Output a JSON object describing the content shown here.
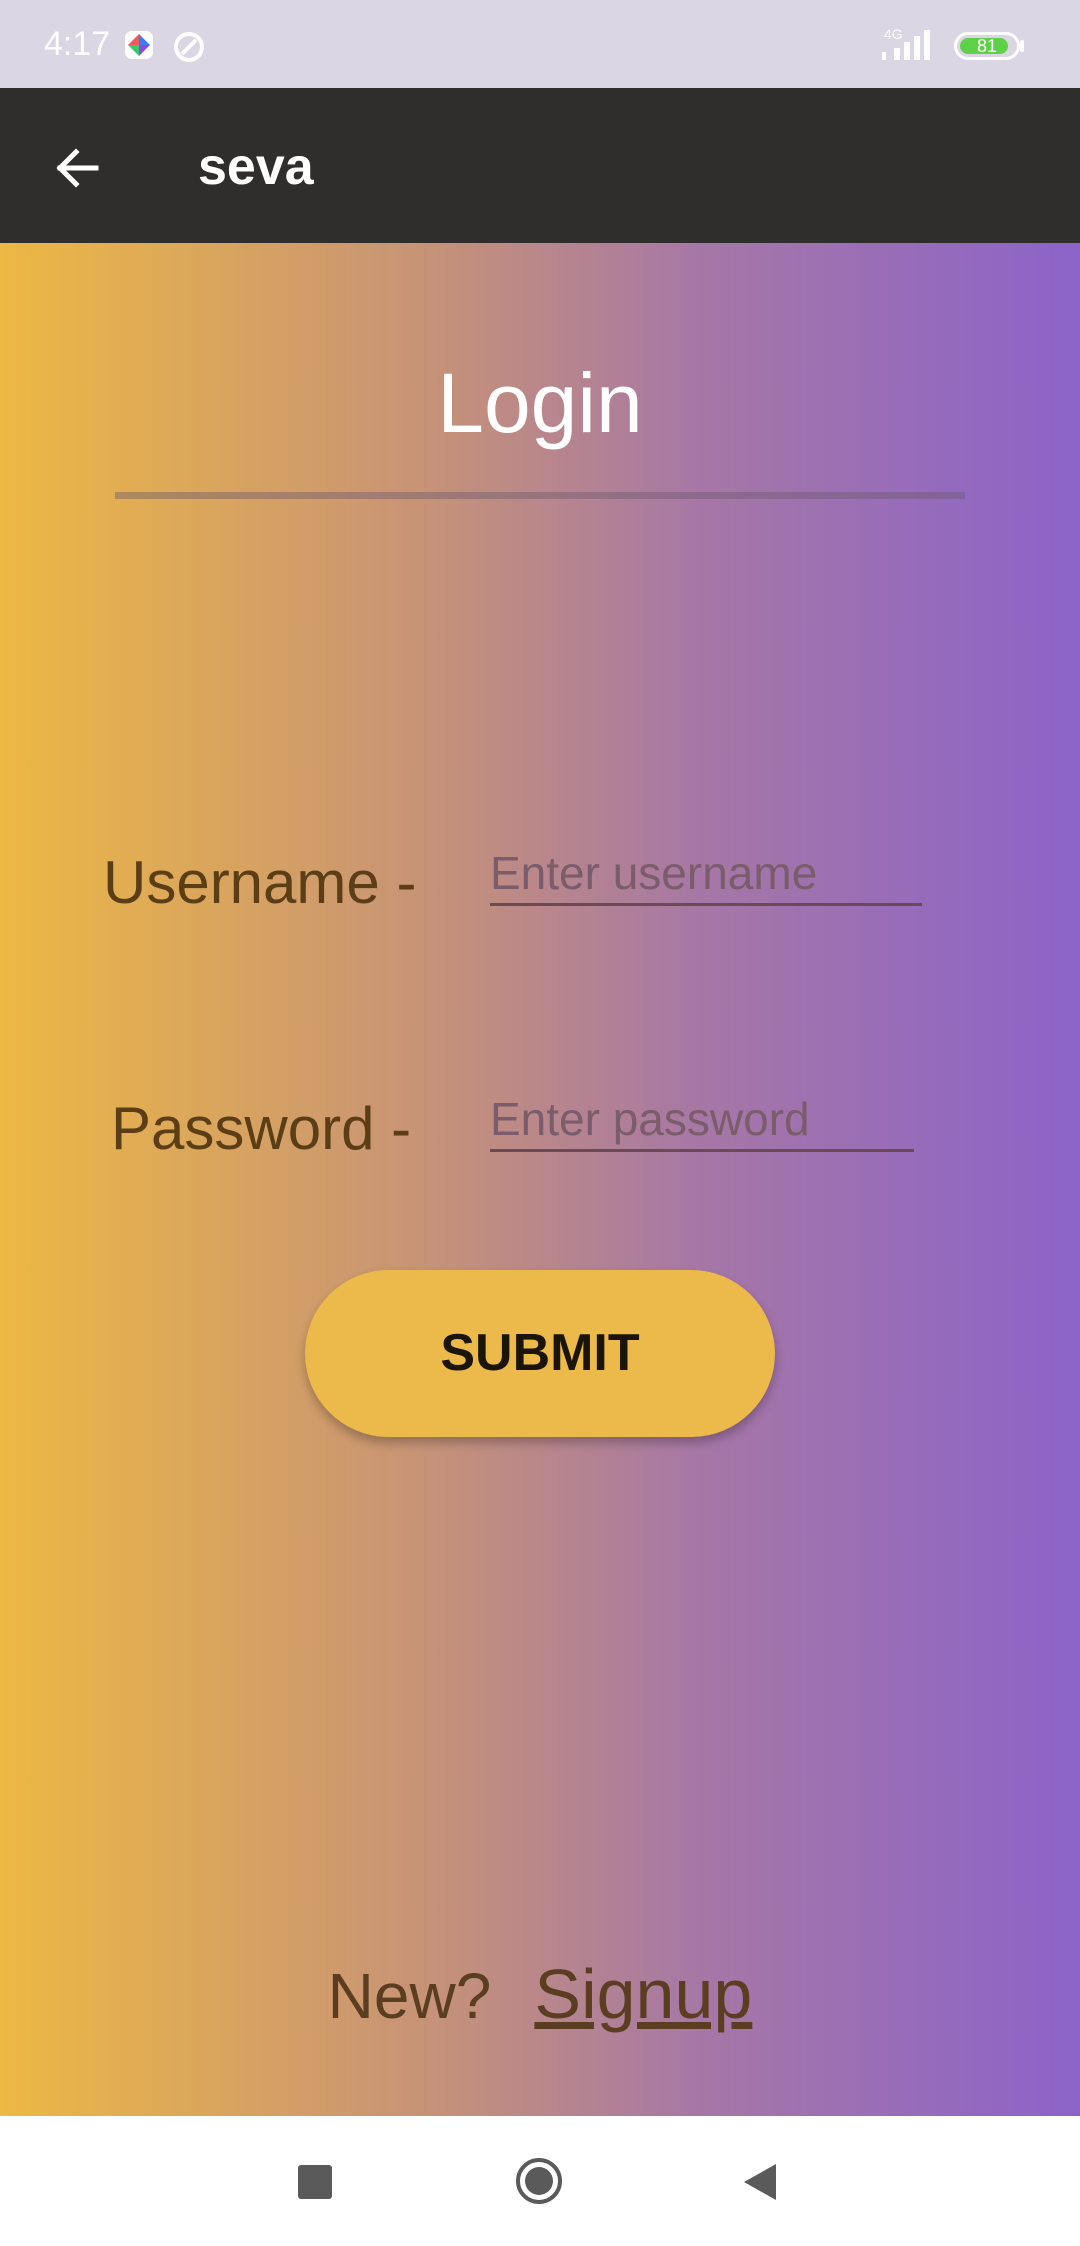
{
  "status_bar": {
    "time": "4:17",
    "network": "4G",
    "battery": "81"
  },
  "app_bar": {
    "title": "seva"
  },
  "login": {
    "title": "Login",
    "username_label": "Username -",
    "username_placeholder": "Enter username",
    "password_label": "Password -",
    "password_placeholder": "Enter password",
    "submit_label": "SUBMIT",
    "signup_prompt": "New?",
    "signup_link": "Signup"
  },
  "colors": {
    "status_bar_bg": "#dbd6e4",
    "app_bar_bg": "#302d2d",
    "gradient_start": "#edb843",
    "gradient_end": "#8b63c9",
    "button_bg": "#ecba4b",
    "label_text": "#5b3e16"
  },
  "icons": {
    "back": "arrow-left-icon",
    "nav_recent": "square-icon",
    "nav_home": "circle-icon",
    "nav_back": "triangle-left-icon"
  }
}
